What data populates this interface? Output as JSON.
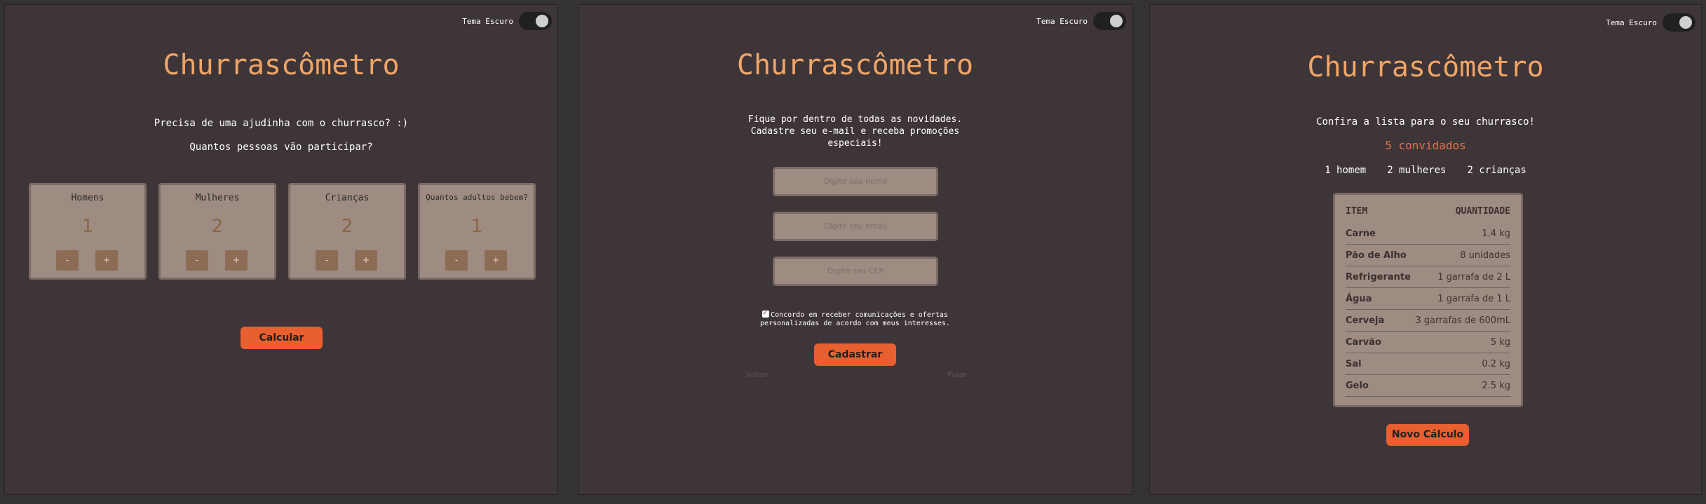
{
  "app_title": "Churrascômetro",
  "theme_toggle_label": "Tema Escuro",
  "screen1": {
    "question": "Precisa de uma ajudinha com o churrasco? :)",
    "subquestion": "Quantos pessoas vão participar?",
    "cards": [
      {
        "label": "Homens",
        "value": "1",
        "minus": "-",
        "plus": "+"
      },
      {
        "label": "Mulheres",
        "value": "2",
        "minus": "-",
        "plus": "+"
      },
      {
        "label": "Crianças",
        "value": "2",
        "minus": "-",
        "plus": "+"
      },
      {
        "label": "Quantos adultos bebem?",
        "value": "1",
        "minus": "-",
        "plus": "+"
      }
    ],
    "calc_button": "Calcular"
  },
  "screen2": {
    "intro_line1": "Fique por dentro de todas as novidades.",
    "intro_line2": "Cadastre seu e-mail e receba promoções",
    "intro_line3": "especiais!",
    "name_placeholder": "Digite seu nome",
    "email_placeholder": "Digite seu email",
    "cep_placeholder": "Digite seu CEP",
    "consent_line1": "Concordo em receber comunicações e ofertas",
    "consent_line2": "personalizadas de acordo com meus interesses.",
    "submit_button": "Cadastrar",
    "back_link": "Voltar",
    "skip_link": "Pular"
  },
  "screen3": {
    "heading": "Confira a lista para o seu churrasco!",
    "guests_total": "5 convidados",
    "men": "1 homem",
    "women": "2 mulheres",
    "children": "2 crianças",
    "col_item": "ITEM",
    "col_qty": "QUANTIDADE",
    "rows": [
      {
        "item": "Carne",
        "qty": "1.4 kg"
      },
      {
        "item": "Pão de Alho",
        "qty": "8 unidades"
      },
      {
        "item": "Refrigerante",
        "qty": "1 garrafa de 2 L"
      },
      {
        "item": "Água",
        "qty": "1 garrafa de 1 L"
      },
      {
        "item": "Cerveja",
        "qty": "3 garrafas de 600mL"
      },
      {
        "item": "Carvão",
        "qty": "5 kg"
      },
      {
        "item": "Sal",
        "qty": "0.2 kg"
      },
      {
        "item": "Gelo",
        "qty": "2.5 kg"
      }
    ],
    "new_calc_button": "Novo Cálculo"
  },
  "colors": {
    "accent": "#e85f30",
    "title": "#f0a566",
    "guests_total": "#e8704a",
    "panel_bg": "#3e3539",
    "card_bg": "#9e8b82"
  }
}
